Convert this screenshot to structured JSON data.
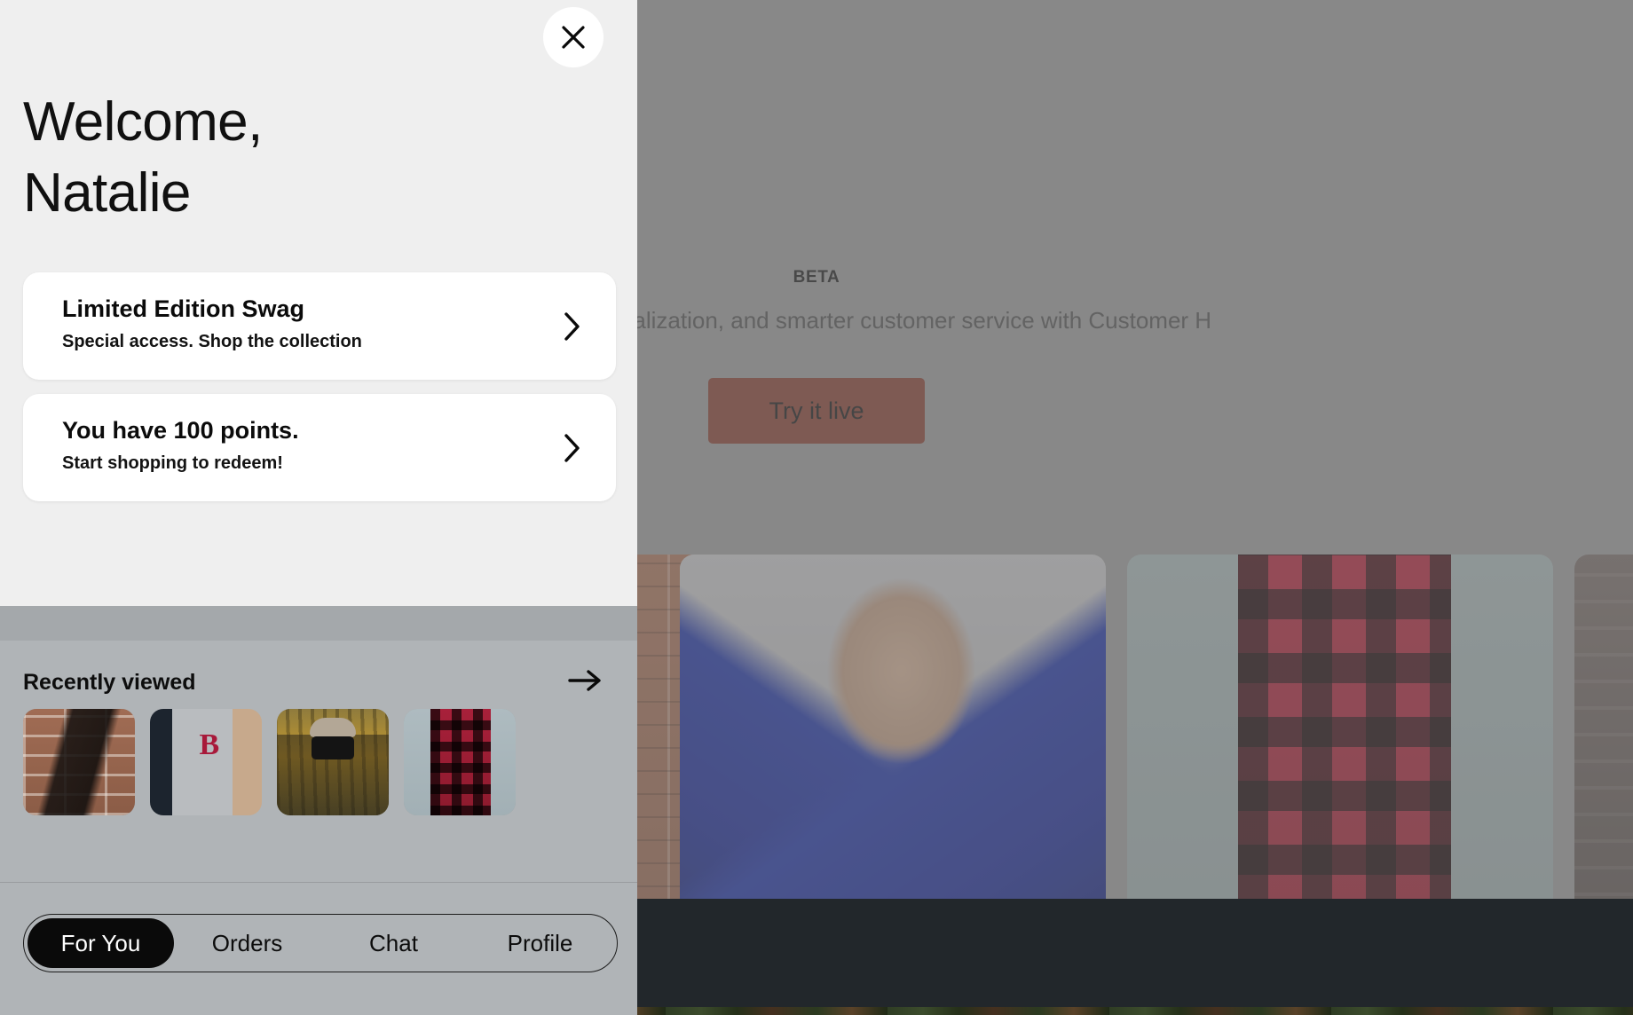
{
  "background": {
    "beta_badge": "BETA",
    "subtitle": "engagement, personalization, and smarter customer service with Customer H",
    "cta_label": "Try it live",
    "cta_color": "#7c3a2d",
    "product_cards": [
      {
        "name": "brick-wall-product",
        "alt": "Person against brick wall"
      },
      {
        "name": "blue-tuxedo-product",
        "alt": "Man in blue floral tuxedo jacket with bow tie"
      },
      {
        "name": "plaid-flannel-product",
        "alt": "Red and black buffalo plaid flannel shirt"
      },
      {
        "name": "dark-product",
        "alt": "Dark textured product image"
      }
    ]
  },
  "panel": {
    "close_icon": "close-icon",
    "greeting": "Welcome,\nNatalie",
    "greeting_line1": "Welcome,",
    "greeting_line2": "Natalie",
    "background_color": "#efefef",
    "cards": [
      {
        "title": "Limited Edition Swag",
        "subtitle": "Special access. Shop the collection",
        "chevron": "chevron-right-icon"
      },
      {
        "title": "You have 100 points.",
        "subtitle": "Start shopping to redeem!",
        "chevron": "chevron-right-icon"
      }
    ],
    "recently_viewed": {
      "heading": "Recently viewed",
      "arrow_icon": "arrow-right-icon",
      "items": [
        {
          "name": "leather-handbag",
          "alt": "Woman with black leather handbag against brick wall"
        },
        {
          "name": "varsity-jacket",
          "alt": "Grey varsity jacket with red letter B",
          "letter": "B"
        },
        {
          "name": "striped-sweater",
          "alt": "Person with camera wearing yellow striped sweater and beanie"
        },
        {
          "name": "plaid-shirt",
          "alt": "Red and black plaid flannel shirt"
        }
      ]
    },
    "nav": {
      "active_index": 0,
      "active_bg": "#0a0a0a",
      "items": [
        {
          "label": "For You"
        },
        {
          "label": "Orders"
        },
        {
          "label": "Chat"
        },
        {
          "label": "Profile"
        }
      ]
    }
  }
}
